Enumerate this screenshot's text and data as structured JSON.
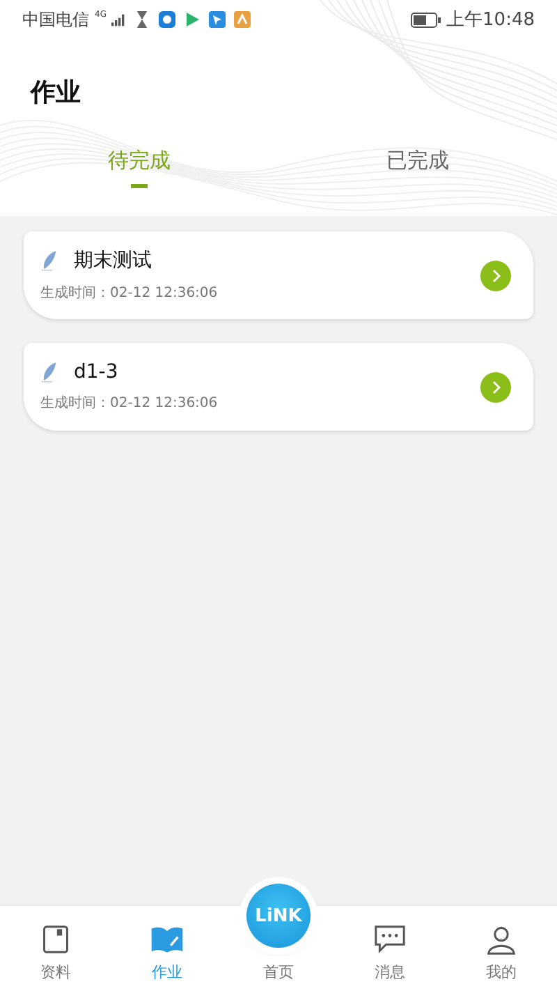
{
  "status_bar": {
    "carrier": "中国电信",
    "network": "4G",
    "time": "上午10:48"
  },
  "header": {
    "title": "作业"
  },
  "tabs": [
    {
      "label": "待完成",
      "selected": true
    },
    {
      "label": "已完成",
      "selected": false
    }
  ],
  "assignments": [
    {
      "title": "期末测试",
      "created": "生成时间：02-12 12:36:06"
    },
    {
      "title": "d1-3",
      "created": "生成时间：02-12 12:36:06"
    }
  ],
  "bottom_nav": [
    {
      "kind": "book",
      "label": "资料",
      "selected": false
    },
    {
      "kind": "open-book",
      "label": "作业",
      "selected": true
    },
    {
      "kind": "logo",
      "logo": "LiNK",
      "label": "首页",
      "selected": false
    },
    {
      "kind": "chat",
      "label": "消息",
      "selected": false
    },
    {
      "kind": "person",
      "label": "我的",
      "selected": false
    }
  ]
}
